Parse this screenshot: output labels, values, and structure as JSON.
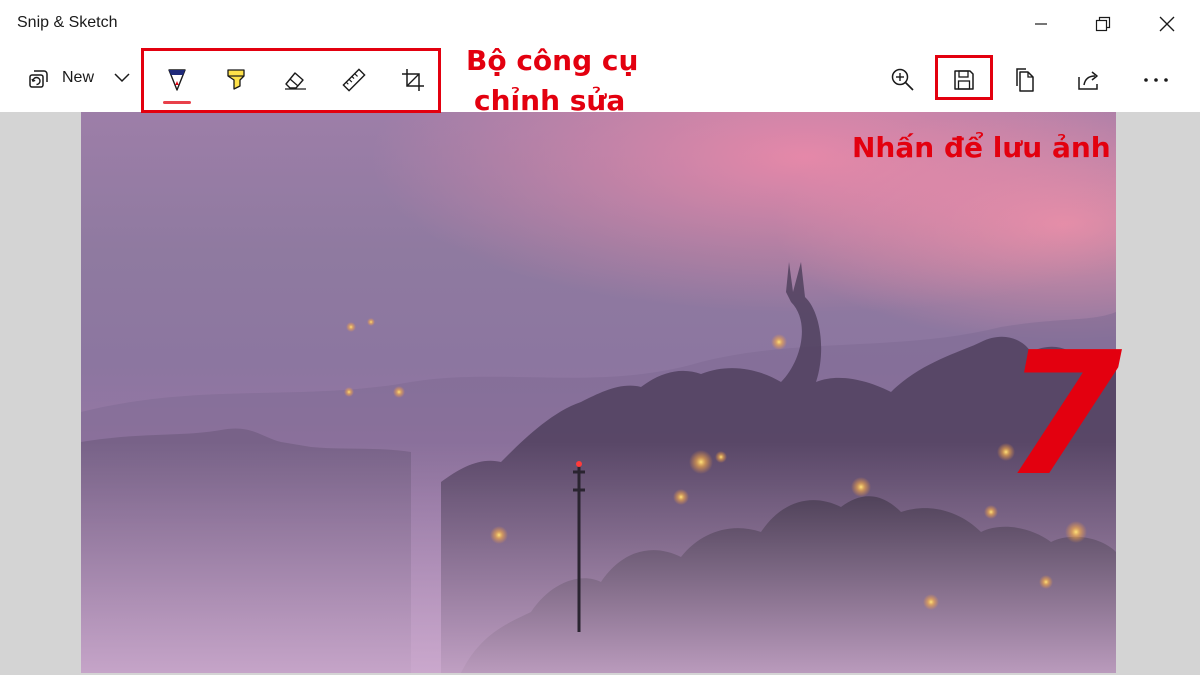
{
  "window": {
    "title": "Snip & Sketch",
    "controls": [
      "minimize-icon",
      "maximize-icon",
      "close-icon"
    ]
  },
  "toolbar": {
    "new_label": "New",
    "new_icon": "new-snip-icon",
    "dropdown_icon": "chevron-down-icon",
    "tools": [
      {
        "name": "ballpoint-pen",
        "icon": "pen-icon",
        "selected": true
      },
      {
        "name": "highlighter",
        "icon": "highlighter-icon",
        "selected": false
      },
      {
        "name": "eraser",
        "icon": "eraser-icon",
        "selected": false
      },
      {
        "name": "ruler",
        "icon": "ruler-icon",
        "selected": false
      },
      {
        "name": "image-crop",
        "icon": "crop-icon",
        "selected": false
      }
    ],
    "actions": [
      {
        "name": "zoom",
        "icon": "zoom-in-icon"
      },
      {
        "name": "save-as",
        "icon": "save-icon"
      },
      {
        "name": "copy",
        "icon": "copy-icon"
      },
      {
        "name": "share",
        "icon": "share-icon"
      },
      {
        "name": "see-more",
        "icon": "more-icon"
      }
    ]
  },
  "annotations": {
    "tools_label_line1": "Bộ công cụ",
    "tools_label_line2": "chỉnh sửa",
    "save_label": "Nhấn để lưu ảnh",
    "step_number": "7",
    "color": "#e3000f"
  },
  "colors": {
    "accent_underline": "#e8404a",
    "canvas_background": "#d4d4d4"
  }
}
